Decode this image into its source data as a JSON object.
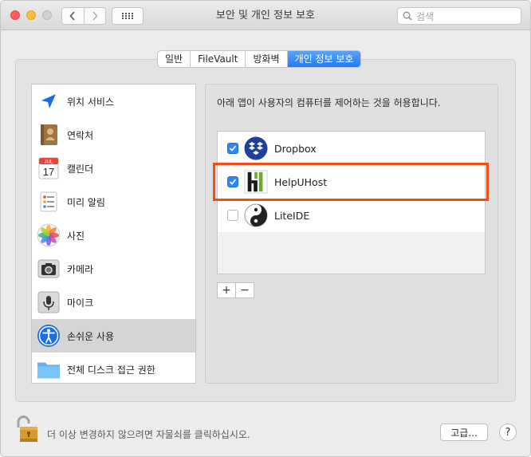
{
  "window": {
    "title": "보안 및 개인 정보 보호"
  },
  "toolbar": {
    "search_placeholder": "검색",
    "back_icon": "chevron-left-icon",
    "forward_icon": "chevron-right-icon",
    "show_all_icon": "grid-icon"
  },
  "tabs": [
    {
      "label": "일반",
      "active": false
    },
    {
      "label": "FileVault",
      "active": false
    },
    {
      "label": "방화벽",
      "active": false
    },
    {
      "label": "개인 정보 보호",
      "active": true
    }
  ],
  "sidebar": {
    "items": [
      {
        "label": "위치 서비스",
        "icon": "location-arrow-icon",
        "selected": false
      },
      {
        "label": "연락처",
        "icon": "contacts-book-icon",
        "selected": false
      },
      {
        "label": "캘린더",
        "icon": "calendar-icon",
        "selected": false
      },
      {
        "label": "미리 알림",
        "icon": "reminders-icon",
        "selected": false
      },
      {
        "label": "사진",
        "icon": "photos-icon",
        "selected": false
      },
      {
        "label": "카메라",
        "icon": "camera-icon",
        "selected": false
      },
      {
        "label": "마이크",
        "icon": "microphone-icon",
        "selected": false
      },
      {
        "label": "손쉬운 사용",
        "icon": "accessibility-icon",
        "selected": true
      },
      {
        "label": "전체 디스크 접근 권한",
        "icon": "folder-icon",
        "selected": false
      }
    ],
    "calendar_month": "JUL",
    "calendar_day": "17"
  },
  "panel": {
    "description": "아래 앱이 사용자의 컴퓨터를 제어하는 것을 허용합니다.",
    "apps": [
      {
        "name": "Dropbox",
        "checked": true,
        "icon": "dropbox-icon"
      },
      {
        "name": "HelpUHost",
        "checked": true,
        "icon": "helpuhost-icon"
      },
      {
        "name": "LiteIDE",
        "checked": false,
        "icon": "liteide-icon"
      }
    ],
    "add_label": "+",
    "remove_label": "−"
  },
  "footer": {
    "lock_text": "더 이상 변경하지 않으려면 자물쇠를 클릭하십시오.",
    "advanced_label": "고급...",
    "help_label": "?"
  },
  "colors": {
    "accent": "#2d86f7",
    "highlight": "#f04e16"
  }
}
